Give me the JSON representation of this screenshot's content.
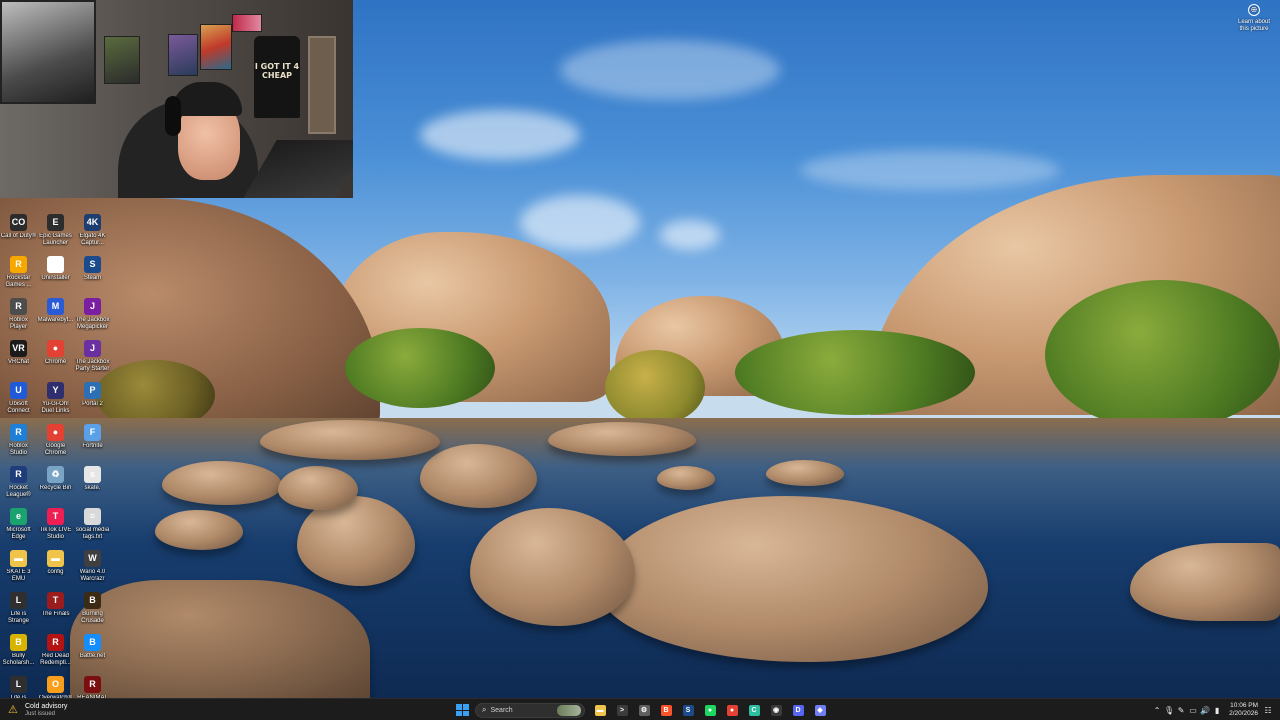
{
  "webcam": {
    "shirt_text": "I GOT IT 4 CHEAP"
  },
  "desktop": {
    "learn_label": "Learn about this picture",
    "icons": [
      {
        "label": "Call of Duty®",
        "glyph": "CO",
        "color": "#2b2b2b"
      },
      {
        "label": "Epic Games Launcher",
        "glyph": "E",
        "color": "#2d2d2d"
      },
      {
        "label": "Elgato 4K Captur...",
        "glyph": "4K",
        "color": "#1d3e6e"
      },
      {
        "label": "Rockstar Games ...",
        "glyph": "R",
        "color": "#f6a800"
      },
      {
        "label": "Uninstaller",
        "glyph": "G",
        "color": "#ffffff"
      },
      {
        "label": "Steam",
        "glyph": "S",
        "color": "#1b4b8c"
      },
      {
        "label": "Roblox Player",
        "glyph": "R",
        "color": "#4d4d4d"
      },
      {
        "label": "Malwarebyt...",
        "glyph": "M",
        "color": "#2a5bd7"
      },
      {
        "label": "The Jackbox Megapicker",
        "glyph": "J",
        "color": "#7a1fa2"
      },
      {
        "label": "VRChat",
        "glyph": "VR",
        "color": "#1b1b1b"
      },
      {
        "label": "Chrome",
        "glyph": "●",
        "color": "#e34133"
      },
      {
        "label": "The Jackbox Party Starter",
        "glyph": "J",
        "color": "#6a2fa0"
      },
      {
        "label": "Ubisoft Connect",
        "glyph": "U",
        "color": "#1f5bd8"
      },
      {
        "label": "Yu-Gi-Oh! Duel Links",
        "glyph": "Y",
        "color": "#2f2f6f"
      },
      {
        "label": "Portal 2",
        "glyph": "P",
        "color": "#2d6fb5"
      },
      {
        "label": "Roblox Studio",
        "glyph": "R",
        "color": "#1e7fd6"
      },
      {
        "label": "Google Chrome",
        "glyph": "●",
        "color": "#e34133"
      },
      {
        "label": "Fortnite",
        "glyph": "F",
        "color": "#5aa0e6"
      },
      {
        "label": "Rocket League®",
        "glyph": "R",
        "color": "#1f3d7a"
      },
      {
        "label": "Recycle Bin",
        "glyph": "♻",
        "color": "#7aa4c6"
      },
      {
        "label": "skate.",
        "glyph": "s",
        "color": "#e6e6e6"
      },
      {
        "label": "Microsoft Edge",
        "glyph": "e",
        "color": "#1aa36f"
      },
      {
        "label": "TikTok LIVE Studio",
        "glyph": "T",
        "color": "#ee1d52"
      },
      {
        "label": "social media tags.txt",
        "glyph": "≡",
        "color": "#d9d9d9"
      },
      {
        "label": "SKATE 3 EMU",
        "glyph": "▬",
        "color": "#f0c34a"
      },
      {
        "label": "config",
        "glyph": "▬",
        "color": "#f0c34a"
      },
      {
        "label": "Wario 4.0 Warcrazr",
        "glyph": "W",
        "color": "#3f3f3f"
      },
      {
        "label": "Life is Strange",
        "glyph": "L",
        "color": "#2f2f2f"
      },
      {
        "label": "The Finals",
        "glyph": "T",
        "color": "#9a1c1c"
      },
      {
        "label": "Burning Crusade",
        "glyph": "B",
        "color": "#3b2a14"
      },
      {
        "label": "Bully Scholarsh...",
        "glyph": "B",
        "color": "#d8b400"
      },
      {
        "label": "Red Dead Redempti...",
        "glyph": "R",
        "color": "#b31313"
      },
      {
        "label": "Battle.net",
        "glyph": "B",
        "color": "#148eff"
      },
      {
        "label": "Life is Strange",
        "glyph": "L",
        "color": "#2f2f2f"
      },
      {
        "label": "Overwatch® 2",
        "glyph": "O",
        "color": "#f99e1a"
      },
      {
        "label": "REANIMAL",
        "glyph": "R",
        "color": "#7b0f0f"
      }
    ]
  },
  "taskbar": {
    "weather_title": "Cold advisory",
    "weather_sub": "Just issued",
    "search_placeholder": "Search",
    "apps": [
      {
        "name": "file-explorer-icon",
        "glyph": "▬",
        "color": "#f0c34a"
      },
      {
        "name": "terminal-icon",
        "glyph": ">",
        "color": "#3c3c3c"
      },
      {
        "name": "settings-icon",
        "glyph": "⚙",
        "color": "#5f5f5f"
      },
      {
        "name": "brave-icon",
        "glyph": "B",
        "color": "#fb542b"
      },
      {
        "name": "steam-icon",
        "glyph": "S",
        "color": "#1b4b8c"
      },
      {
        "name": "spotify-icon",
        "glyph": "●",
        "color": "#1ed760"
      },
      {
        "name": "chrome-icon",
        "glyph": "●",
        "color": "#e34133"
      },
      {
        "name": "capcut-icon",
        "glyph": "C",
        "color": "#2bbfa0"
      },
      {
        "name": "obs-icon",
        "glyph": "◉",
        "color": "#3a3a3a"
      },
      {
        "name": "discord-icon",
        "glyph": "D",
        "color": "#5865f2"
      },
      {
        "name": "app-icon",
        "glyph": "◆",
        "color": "#6f7ef5"
      }
    ],
    "time": "10:06 PM",
    "date": "2/20/2026"
  }
}
